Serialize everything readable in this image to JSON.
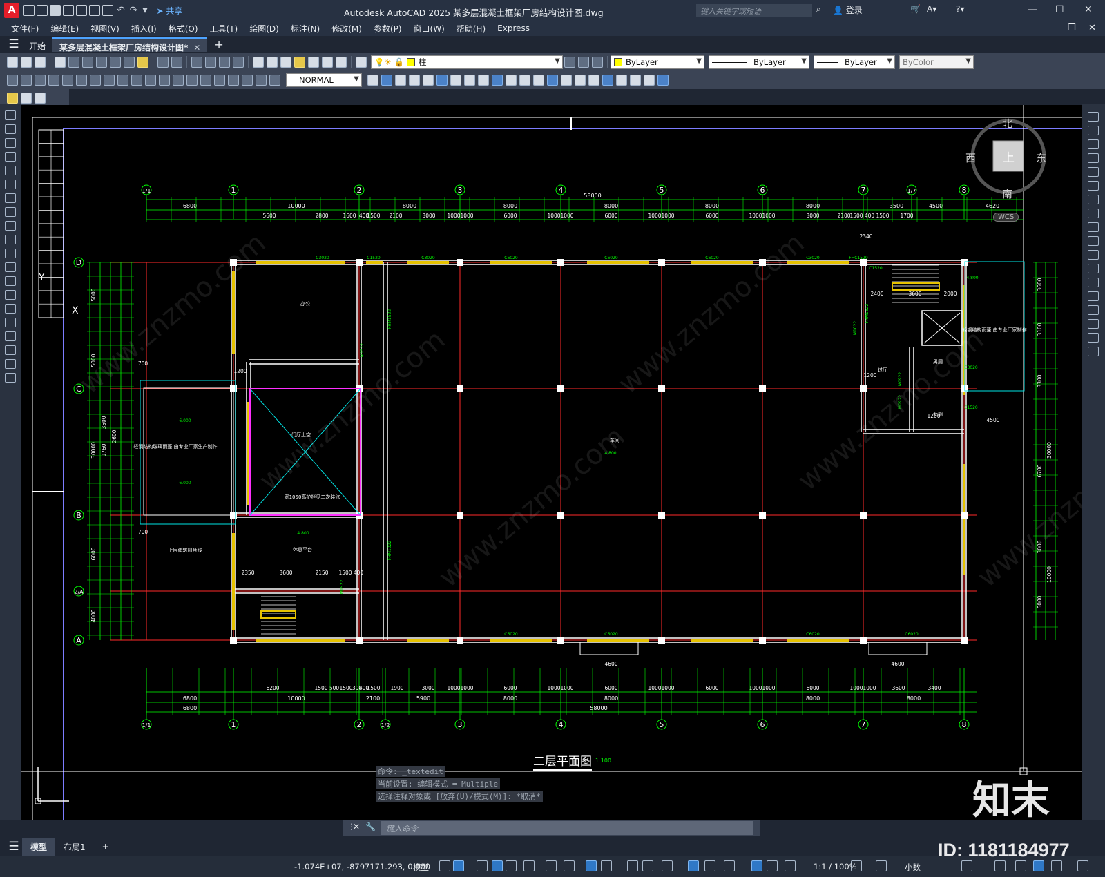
{
  "app": {
    "logo_letter": "A",
    "share_label": "共享",
    "window_title": "Autodesk AutoCAD 2025    某多层混凝土框架厂房结构设计图.dwg",
    "search_placeholder": "键入关键字或短语",
    "login_label": "登录"
  },
  "menu": [
    "文件(F)",
    "编辑(E)",
    "视图(V)",
    "插入(I)",
    "格式(O)",
    "工具(T)",
    "绘图(D)",
    "标注(N)",
    "修改(M)",
    "参数(P)",
    "窗口(W)",
    "帮助(H)",
    "Express"
  ],
  "tabs": [
    {
      "label": "开始",
      "active": false
    },
    {
      "label": "某多层混凝土框架厂房结构设计图*",
      "active": true
    }
  ],
  "properties": {
    "layer": "柱",
    "color": "ByLayer",
    "linetype": "ByLayer",
    "lineweight": "ByLayer",
    "plotstyle": "ByColor",
    "dimstyle": "NORMAL"
  },
  "viewcube": {
    "north": "北",
    "south": "南",
    "east": "东",
    "west": "西",
    "top": "上",
    "wcs": "WCS"
  },
  "drawing": {
    "title": "二层平面图",
    "scale": "1:100",
    "top_axes": [
      "1/1",
      "1",
      "2",
      "3",
      "4",
      "5",
      "6",
      "7",
      "1/7",
      "8"
    ],
    "bottom_axes": [
      "1/1",
      "1",
      "2",
      "1/2",
      "3",
      "4",
      "5",
      "6",
      "7",
      "8"
    ],
    "left_axes": [
      "D",
      "C",
      "B",
      "2/A",
      "A"
    ],
    "total_width": "58000",
    "top_dims_row2": [
      "6800",
      "10000",
      "8000",
      "8000",
      "8000",
      "8000",
      "8000",
      "3500",
      "4500",
      "4620"
    ],
    "top_dims_row3": [
      "5600",
      "2800",
      "1600",
      "400",
      "1500",
      "2100",
      "3000",
      "1000",
      "1000",
      "6000",
      "1000",
      "1000",
      "6000",
      "1000",
      "1000",
      "6000",
      "1000",
      "1000",
      "3000",
      "2100",
      "1500",
      "400",
      "1500",
      "1700"
    ],
    "bottom_dims_row1": [
      "6200",
      "1500",
      "500",
      "1500",
      "300",
      "400",
      "1500",
      "1900",
      "3000",
      "1000",
      "1000",
      "6000",
      "1000",
      "1000",
      "6000",
      "1000",
      "1000",
      "6000",
      "1000",
      "1000",
      "6000",
      "1000",
      "1000",
      "3600",
      "3400"
    ],
    "bottom_dims_row2": [
      "6800",
      "10000",
      "2100",
      "5900",
      "8000",
      "8000",
      "8000",
      "8000"
    ],
    "left_dims": [
      "5000",
      "5000",
      "30000",
      "6000",
      "4000",
      "3500",
      "9760",
      "2600"
    ],
    "right_dims": [
      "3600",
      "3100",
      "3300",
      "30000",
      "6700",
      "3000",
      "10000",
      "6000"
    ],
    "room_labels": [
      "办公",
      "门厅上空",
      "车间",
      "休息平台",
      "过厅",
      "男厕",
      "女厕",
      "轻钢结构玻璃雨蓬 由专业厂家生产制作",
      "轻钢结构雨蓬 由专业厂家制作",
      "上层建筑阳台线",
      "宽1050高护栏见二次装修"
    ],
    "window_labels": [
      "C3020",
      "C1520",
      "C3020",
      "C6020",
      "C6020",
      "C6020",
      "C3020",
      "FHC1520",
      "C1520",
      "C3020",
      "C1520",
      "C6020",
      "C6020",
      "C6020",
      "C6020"
    ],
    "door_labels": [
      "FHM1522",
      "M1522",
      "FHM1022",
      "M1522",
      "M0922",
      "M0922",
      "FHM1522",
      "M1022"
    ],
    "elevations": [
      "4.800",
      "4.800",
      "4.800",
      "6.000",
      "6.000"
    ],
    "misc_dims": [
      "2340",
      "2400",
      "3600",
      "2000",
      "4500",
      "4600",
      "4600",
      "2350",
      "3600",
      "2150",
      "1500",
      "400",
      "700",
      "700",
      "1200",
      "1200",
      "1200"
    ]
  },
  "command": {
    "history": [
      "命令:  _textedit",
      "当前设置: 编辑模式 = Multiple",
      "选择注释对象或 [放弃(U)/模式(M)]: *取消*"
    ],
    "placeholder": "键入命令"
  },
  "layout_tabs": [
    {
      "label": "模型",
      "active": true
    },
    {
      "label": "布局1",
      "active": false
    }
  ],
  "status": {
    "coords": "-1.074E+07, -8797171.293, 0.000",
    "model": "模型",
    "annoscale": "1:1 / 100%",
    "units": "小数"
  },
  "watermark": {
    "brand": "知末",
    "id": "ID: 1181184977",
    "site": "www.znzmo.com"
  },
  "colors": {
    "accent": "#4da3ff",
    "background": "#000000",
    "axis_red": "#ff2a2a",
    "dim_green": "#00ff00",
    "wall_white": "#ffffff",
    "window_yellow": "#e6c200",
    "cyan": "#00e5e5",
    "magenta": "#ff00ff"
  }
}
